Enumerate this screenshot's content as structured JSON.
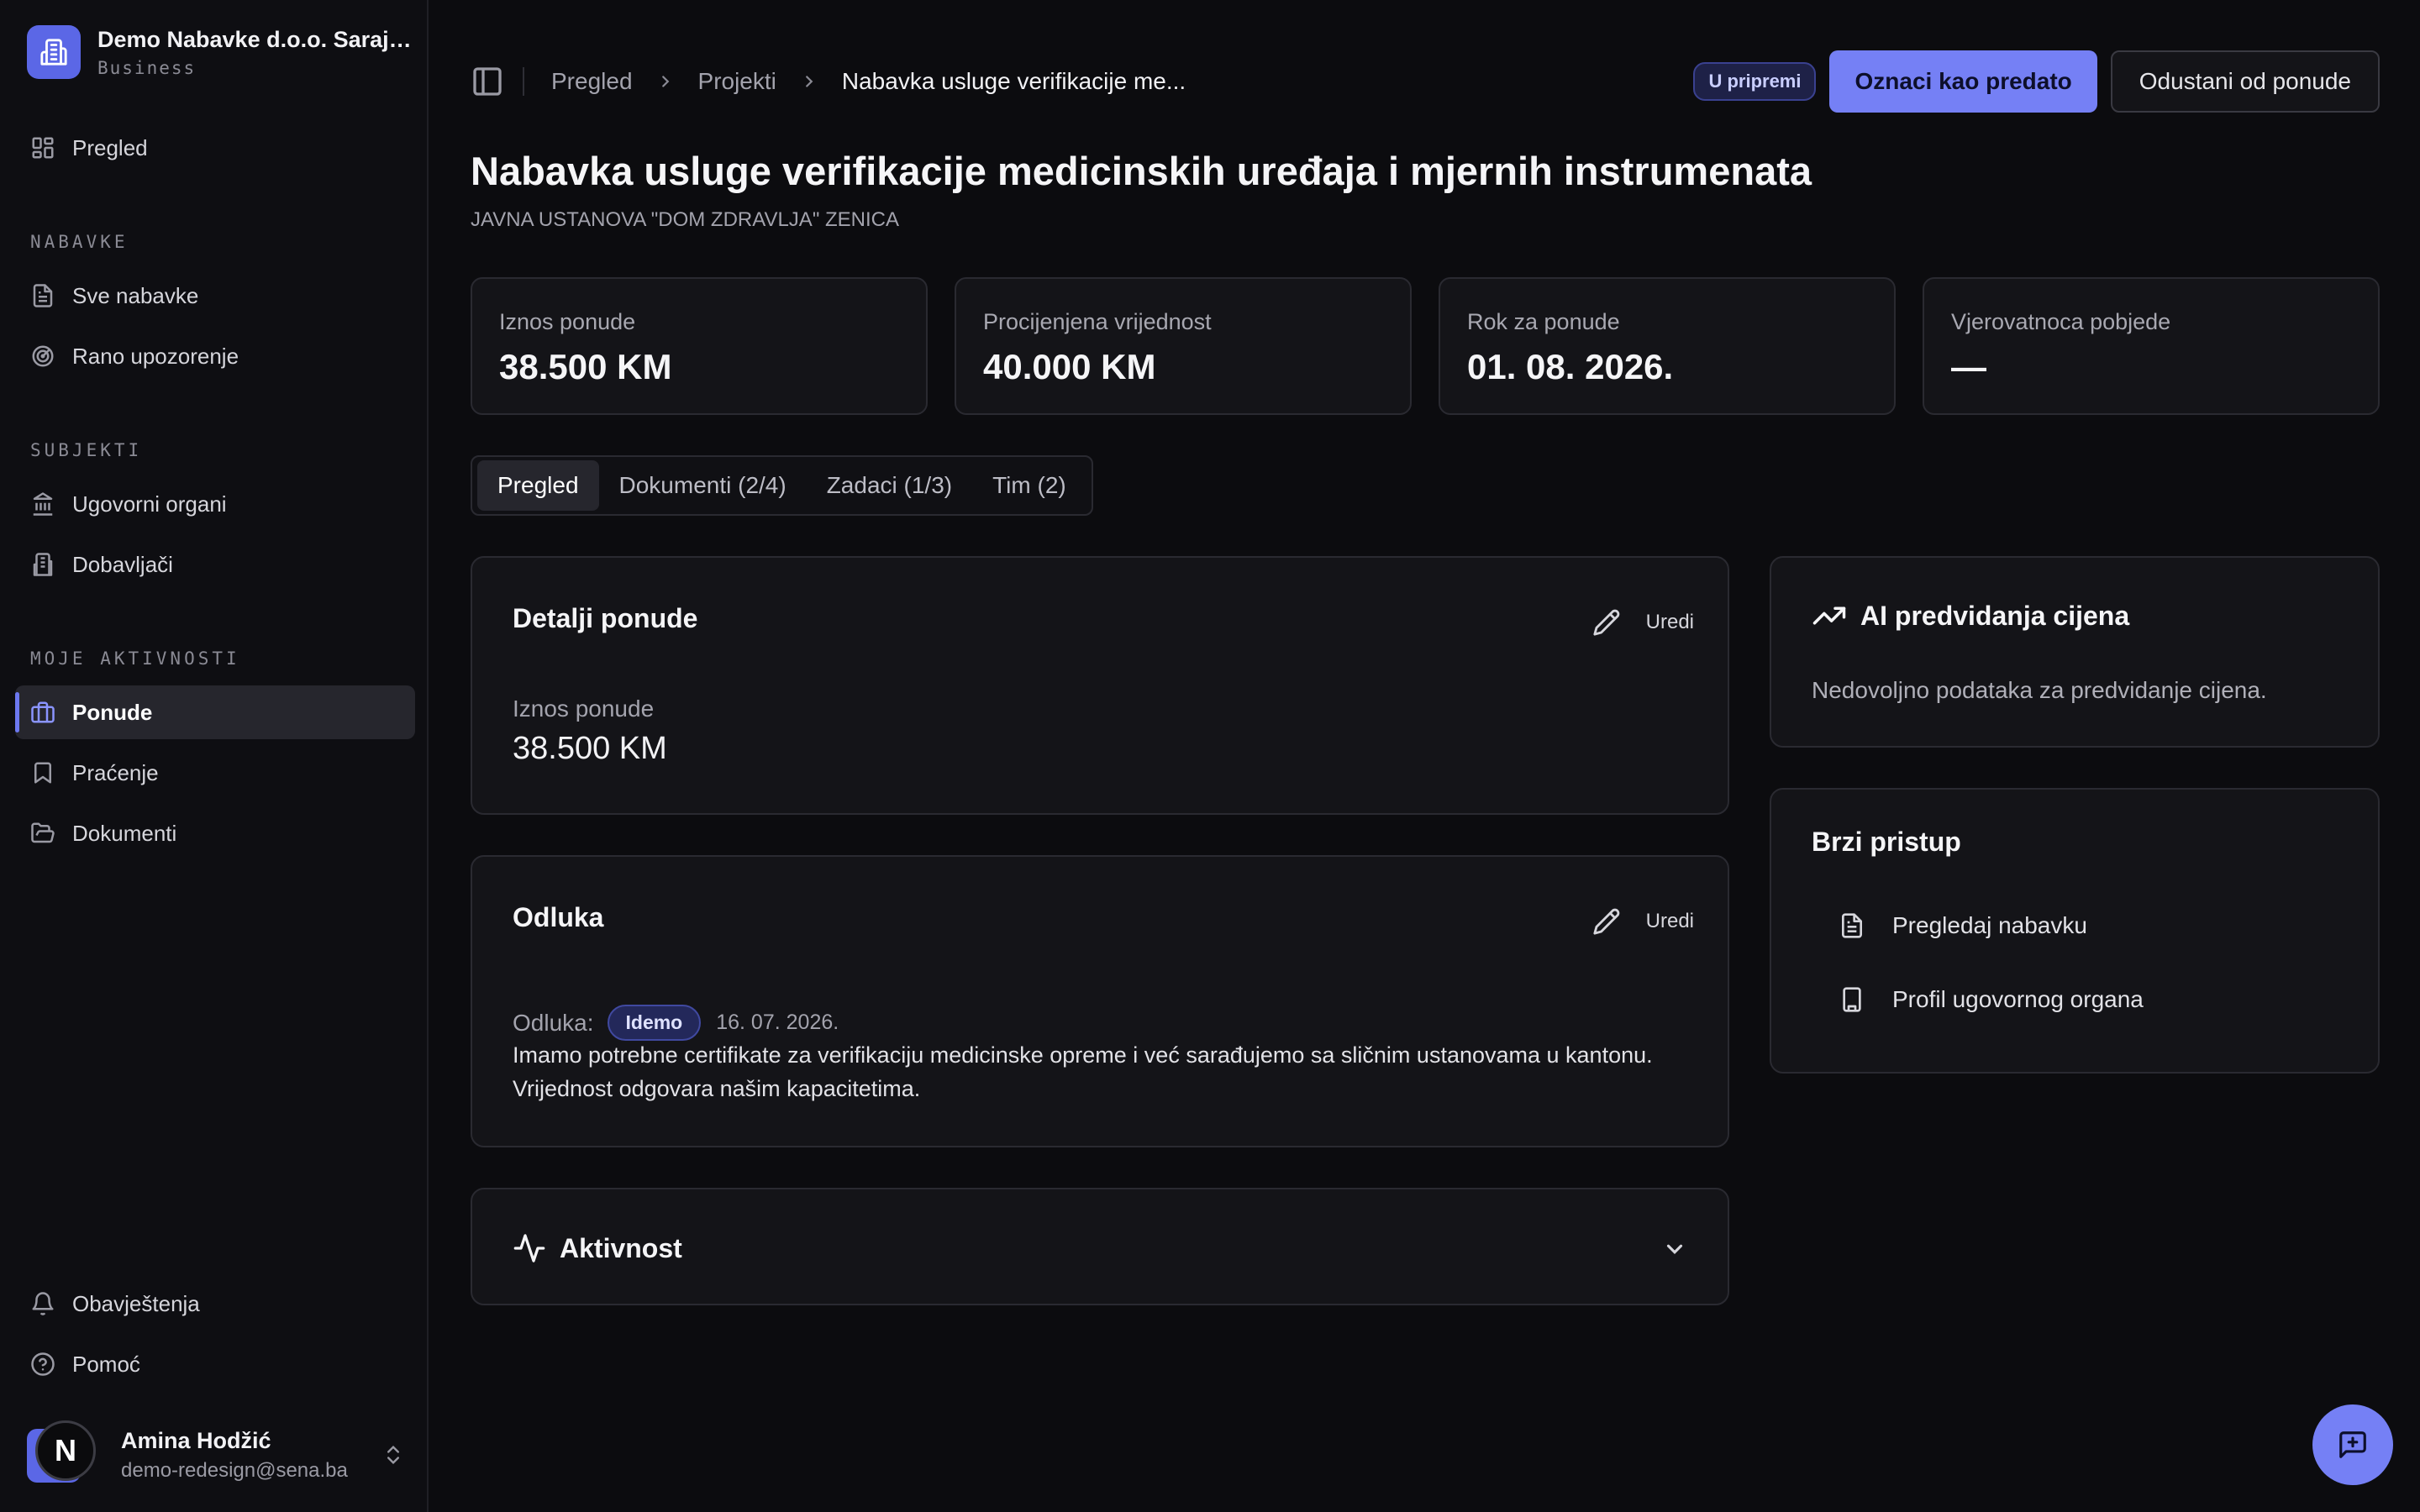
{
  "org": {
    "name": "Demo Nabavke d.o.o. Sarajevo",
    "plan": "Business"
  },
  "sidebar": {
    "overview": "Pregled",
    "sections": [
      {
        "label": "NABAVKE",
        "items": [
          "Sve nabavke",
          "Rano upozorenje"
        ]
      },
      {
        "label": "SUBJEKTI",
        "items": [
          "Ugovorni organi",
          "Dobavljači"
        ]
      },
      {
        "label": "MOJE AKTIVNOSTI",
        "items": [
          "Ponude",
          "Praćenje",
          "Dokumenti"
        ]
      }
    ],
    "footer": [
      "Obavještenja",
      "Pomoć"
    ]
  },
  "user": {
    "name": "Amina Hodžić",
    "email": "demo-redesign@sena.ba",
    "badge": "N"
  },
  "breadcrumb": [
    "Pregled",
    "Projekti",
    "Nabavka usluge verifikacije me..."
  ],
  "status": "U pripremi",
  "actions": {
    "primary": "Oznaci kao predato",
    "secondary": "Odustani od ponude"
  },
  "page": {
    "title": "Nabavka usluge verifikacije medicinskih uređaja i mjernih instrumenata",
    "subtitle": "JAVNA USTANOVA \"DOM ZDRAVLJA\" ZENICA"
  },
  "stats": [
    {
      "label": "Iznos ponude",
      "value": "38.500 KM"
    },
    {
      "label": "Procijenjena vrijednost",
      "value": "40.000 KM"
    },
    {
      "label": "Rok za ponude",
      "value": "01. 08. 2026."
    },
    {
      "label": "Vjerovatnoca pobjede",
      "value": "—"
    }
  ],
  "tabs": [
    "Pregled",
    "Dokumenti (2/4)",
    "Zadaci (1/3)",
    "Tim (2)"
  ],
  "details": {
    "title": "Detalji ponude",
    "edit": "Uredi",
    "field_label": "Iznos ponude",
    "field_value": "38.500 KM"
  },
  "decision": {
    "title": "Odluka",
    "edit": "Uredi",
    "label": "Odluka:",
    "value": "Idemo",
    "date": "16. 07. 2026.",
    "text": "Imamo potrebne certifikate za verifikaciju medicinske opreme i već sarađujemo sa sličnim ustanovama u kantonu. Vrijednost odgovara našim kapacitetima."
  },
  "activity": {
    "title": "Aktivnost"
  },
  "ai": {
    "title": "AI predvidanja cijena",
    "text": "Nedovoljno podataka za predvidanje cijena."
  },
  "quick_access": {
    "title": "Brzi pristup",
    "links": [
      "Pregledaj nabavku",
      "Profil ugovornog organa"
    ]
  },
  "colors": {
    "accent": "#7580f5",
    "background": "#0c0c0f",
    "card": "#141418"
  }
}
